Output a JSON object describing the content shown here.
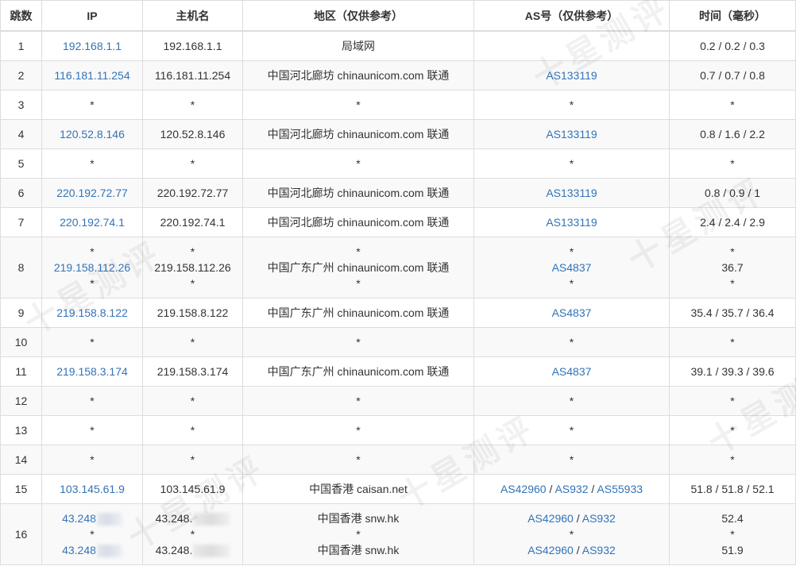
{
  "headers": [
    "跳数",
    "IP",
    "主机名",
    "地区（仅供参考）",
    "AS号（仅供参考）",
    "时间（毫秒）"
  ],
  "rows": [
    {
      "hop": "1",
      "ip": [
        "192.168.1.1"
      ],
      "host": [
        "192.168.1.1"
      ],
      "region": [
        "局域网"
      ],
      "as": [
        []
      ],
      "time": [
        "0.2 / 0.2 / 0.3"
      ]
    },
    {
      "hop": "2",
      "ip": [
        "116.181.11.254"
      ],
      "host": [
        "116.181.11.254"
      ],
      "region": [
        "中国河北廊坊 chinaunicom.com 联通"
      ],
      "as": [
        [
          "AS133119"
        ]
      ],
      "time": [
        "0.7 / 0.7 / 0.8"
      ]
    },
    {
      "hop": "3",
      "ip": [
        "*"
      ],
      "host": [
        "*"
      ],
      "region": [
        "*"
      ],
      "as": [
        [
          "*"
        ]
      ],
      "time": [
        "*"
      ]
    },
    {
      "hop": "4",
      "ip": [
        "120.52.8.146"
      ],
      "host": [
        "120.52.8.146"
      ],
      "region": [
        "中国河北廊坊 chinaunicom.com 联通"
      ],
      "as": [
        [
          "AS133119"
        ]
      ],
      "time": [
        "0.8 / 1.6 / 2.2"
      ]
    },
    {
      "hop": "5",
      "ip": [
        "*"
      ],
      "host": [
        "*"
      ],
      "region": [
        "*"
      ],
      "as": [
        [
          "*"
        ]
      ],
      "time": [
        "*"
      ]
    },
    {
      "hop": "6",
      "ip": [
        "220.192.72.77"
      ],
      "host": [
        "220.192.72.77"
      ],
      "region": [
        "中国河北廊坊 chinaunicom.com 联通"
      ],
      "as": [
        [
          "AS133119"
        ]
      ],
      "time": [
        "0.8 / 0.9 / 1"
      ]
    },
    {
      "hop": "7",
      "ip": [
        "220.192.74.1"
      ],
      "host": [
        "220.192.74.1"
      ],
      "region": [
        "中国河北廊坊 chinaunicom.com 联通"
      ],
      "as": [
        [
          "AS133119"
        ]
      ],
      "time": [
        "2.4 / 2.4 / 2.9"
      ]
    },
    {
      "hop": "8",
      "ip": [
        "*",
        "219.158.112.26",
        "*"
      ],
      "host": [
        "*",
        "219.158.112.26",
        "*"
      ],
      "region": [
        "*",
        "中国广东广州 chinaunicom.com 联通",
        "*"
      ],
      "as": [
        [
          "*"
        ],
        [
          "AS4837"
        ],
        [
          "*"
        ]
      ],
      "time": [
        "*",
        "36.7",
        "*"
      ]
    },
    {
      "hop": "9",
      "ip": [
        "219.158.8.122"
      ],
      "host": [
        "219.158.8.122"
      ],
      "region": [
        "中国广东广州 chinaunicom.com 联通"
      ],
      "as": [
        [
          "AS4837"
        ]
      ],
      "time": [
        "35.4 / 35.7 / 36.4"
      ]
    },
    {
      "hop": "10",
      "ip": [
        "*"
      ],
      "host": [
        "*"
      ],
      "region": [
        "*"
      ],
      "as": [
        [
          "*"
        ]
      ],
      "time": [
        "*"
      ]
    },
    {
      "hop": "11",
      "ip": [
        "219.158.3.174"
      ],
      "host": [
        "219.158.3.174"
      ],
      "region": [
        "中国广东广州 chinaunicom.com 联通"
      ],
      "as": [
        [
          "AS4837"
        ]
      ],
      "time": [
        "39.1 / 39.3 / 39.6"
      ]
    },
    {
      "hop": "12",
      "ip": [
        "*"
      ],
      "host": [
        "*"
      ],
      "region": [
        "*"
      ],
      "as": [
        [
          "*"
        ]
      ],
      "time": [
        "*"
      ]
    },
    {
      "hop": "13",
      "ip": [
        "*"
      ],
      "host": [
        "*"
      ],
      "region": [
        "*"
      ],
      "as": [
        [
          "*"
        ]
      ],
      "time": [
        "*"
      ]
    },
    {
      "hop": "14",
      "ip": [
        "*"
      ],
      "host": [
        "*"
      ],
      "region": [
        "*"
      ],
      "as": [
        [
          "*"
        ]
      ],
      "time": [
        "*"
      ]
    },
    {
      "hop": "15",
      "ip": [
        "103.145.61.9"
      ],
      "host": [
        "103.145.61.9"
      ],
      "region": [
        "中国香港 caisan.net"
      ],
      "as": [
        [
          "AS42960",
          "AS932",
          "AS55933"
        ]
      ],
      "time": [
        "51.8 / 51.8 / 52.1"
      ]
    },
    {
      "hop": "16",
      "ip": [
        "43.248",
        "*",
        "43.248"
      ],
      "host": [
        "43.248.",
        "*",
        "43.248."
      ],
      "region": [
        "中国香港 snw.hk",
        "*",
        "中国香港 snw.hk"
      ],
      "as": [
        [
          "AS42960",
          "AS932"
        ],
        [
          "*"
        ],
        [
          "AS42960",
          "AS932"
        ]
      ],
      "time": [
        "52.4",
        "*",
        "51.9"
      ]
    }
  ],
  "watermark": "十星测评",
  "colors": {
    "link": "#3273b8",
    "border": "#dddddd",
    "stripe": "#f9f9f9",
    "text": "#333333"
  }
}
